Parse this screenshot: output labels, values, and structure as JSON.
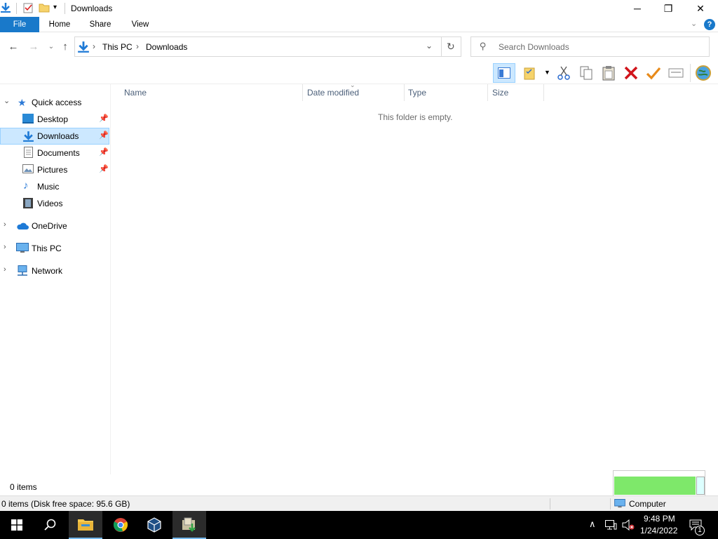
{
  "window": {
    "title": "Downloads",
    "minimize_glyph": "─",
    "restore_glyph": "❐",
    "close_glyph": "✕"
  },
  "ribbon": {
    "tabs": [
      "File",
      "Home",
      "Share",
      "View"
    ],
    "help_glyph": "?"
  },
  "address": {
    "crumbs": [
      "This PC",
      "Downloads"
    ],
    "separator": "›",
    "search_placeholder": "Search Downloads"
  },
  "nav": {
    "quick_access": "Quick access",
    "items": [
      {
        "label": "Desktop",
        "pinned": true
      },
      {
        "label": "Downloads",
        "pinned": true
      },
      {
        "label": "Documents",
        "pinned": true
      },
      {
        "label": "Pictures",
        "pinned": true
      },
      {
        "label": "Music",
        "pinned": false
      },
      {
        "label": "Videos",
        "pinned": false
      }
    ],
    "roots": [
      "OneDrive",
      "This PC",
      "Network"
    ]
  },
  "content": {
    "columns": [
      "Name",
      "Date modified",
      "Type",
      "Size"
    ],
    "empty_text": "This folder is empty."
  },
  "status": {
    "items": "0 items",
    "disk": "0 items (Disk free space: 95.6 GB)",
    "computer": "Computer"
  },
  "taskbar": {
    "time": "9:48 PM",
    "date": "1/24/2022",
    "notification_count": "1"
  },
  "colors": {
    "accent": "#1979ca",
    "selection": "#cce8ff",
    "popup_green": "#7ee86a"
  }
}
